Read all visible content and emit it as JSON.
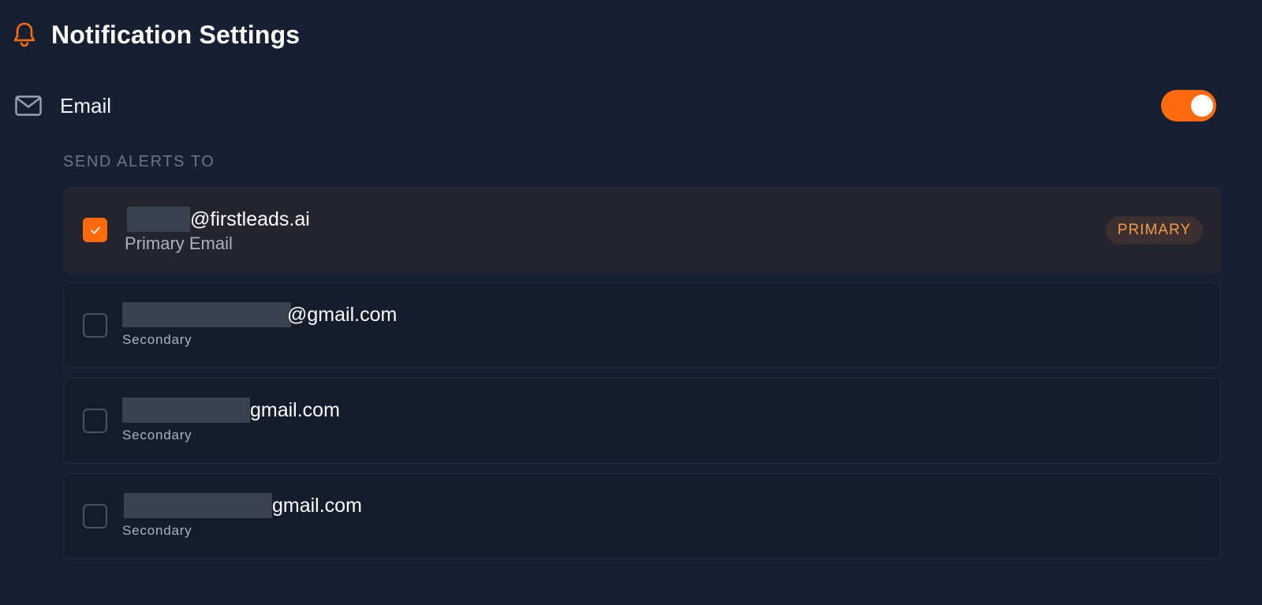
{
  "header": {
    "icon": "bell-icon",
    "title": "Notification Settings"
  },
  "channel": {
    "icon": "mail-icon",
    "label": "Email",
    "enabled": true
  },
  "section_label": "SEND ALERTS TO",
  "emails": [
    {
      "address_suffix": "@firstleads.ai",
      "subtitle": "Primary Email",
      "checked": true,
      "badge": "PRIMARY"
    },
    {
      "address_suffix": "@gmail.com",
      "subtitle": "Secondary",
      "checked": false
    },
    {
      "address_suffix": "gmail.com",
      "subtitle": "Secondary",
      "checked": false
    },
    {
      "address_suffix": "gmail.com",
      "subtitle": "Secondary",
      "checked": false
    }
  ],
  "colors": {
    "accent": "#ff6a0d",
    "background": "#172033",
    "card": "#151c2e",
    "card_selected": "#24242f",
    "badge_text": "#f59a4a"
  }
}
